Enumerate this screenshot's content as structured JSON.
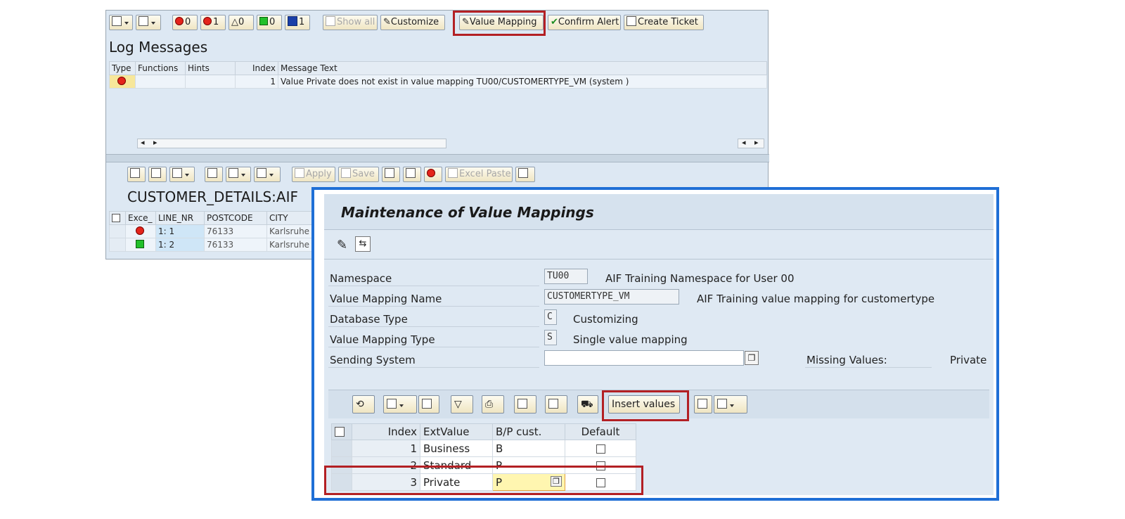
{
  "log_window": {
    "toolbar": {
      "err_count": "0",
      "red_count": "1",
      "warn_count": "0",
      "ok_count": "0",
      "info_count": "1",
      "show_all": "Show all",
      "customize": "Customize",
      "value_mapping": "Value Mapping",
      "confirm_alert": "Confirm Alert",
      "create_ticket": "Create Ticket"
    },
    "title": "Log Messages",
    "columns": [
      "Type",
      "Functions",
      "Hints",
      "Index",
      "Message Text"
    ],
    "rows": [
      {
        "index": "1",
        "message": "Value Private does not exist in value mapping TU00/CUSTOMERTYPE_VM (system )"
      }
    ],
    "data_toolbar": {
      "apply": "Apply",
      "save": "Save",
      "excel_paste": "Excel Paste"
    },
    "data_title": "CUSTOMER_DETAILS:AIF",
    "data_columns": [
      "Exce_",
      "LINE_NR",
      "POSTCODE",
      "CITY"
    ],
    "data_rows": [
      {
        "line_nr": "1: 1",
        "postcode": "76133",
        "city": "Karlsruhe",
        "status": "error"
      },
      {
        "line_nr": "1: 2",
        "postcode": "76133",
        "city": "Karlsruhe",
        "status": "ok"
      }
    ]
  },
  "mapping_window": {
    "title": "Maintenance of Value Mappings",
    "fields": {
      "namespace": {
        "label": "Namespace",
        "value": "TU00",
        "desc": "AIF Training Namespace for User 00"
      },
      "vm_name": {
        "label": "Value Mapping Name",
        "value": "CUSTOMERTYPE_VM",
        "desc": "AIF Training value mapping for customertype"
      },
      "db_type": {
        "label": "Database Type",
        "value": "C",
        "desc": "Customizing"
      },
      "vm_type": {
        "label": "Value Mapping Type",
        "value": "S",
        "desc": "Single value mapping"
      },
      "sending_system": {
        "label": "Sending System",
        "value": ""
      },
      "missing_values": {
        "label": "Missing Values:",
        "value": "Private"
      }
    },
    "insert_values": "Insert values",
    "table_columns": [
      "Index",
      "ExtValue",
      "B/P cust.",
      "Default"
    ],
    "table_rows": [
      {
        "index": "1",
        "ext": "Business",
        "bp": "B"
      },
      {
        "index": "2",
        "ext": "Standard",
        "bp": "P"
      },
      {
        "index": "3",
        "ext": "Private",
        "bp": "P"
      }
    ],
    "colors": {
      "frame": "#1f6fd6",
      "highlight": "#b32024"
    }
  }
}
